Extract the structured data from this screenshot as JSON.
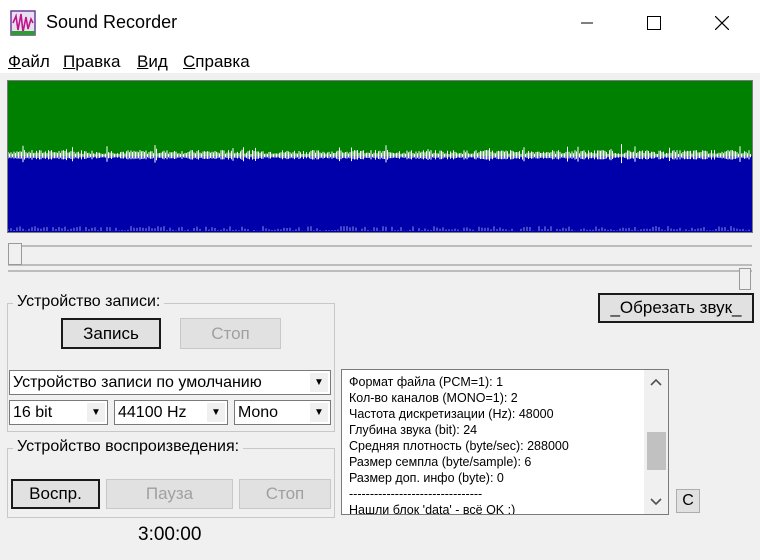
{
  "window": {
    "title": "Sound Recorder"
  },
  "menu": [
    {
      "accel": "Ф",
      "rest": "айл"
    },
    {
      "accel": "П",
      "rest": "равка"
    },
    {
      "accel": "В",
      "rest": "ид"
    },
    {
      "accel": "С",
      "rest": "правка"
    }
  ],
  "colors": {
    "wave_top": "#008000",
    "wave_bottom": "#0000aa",
    "wave_peaks": "#ffffff"
  },
  "trim_button": "_Обрезать звук_",
  "record_group": {
    "label": "Устройство записи:",
    "record_button": "Запись",
    "stop_button": "Стоп",
    "device": "Устройство записи по умолчанию",
    "bits": "16 bit",
    "rate": "44100 Hz",
    "channels": "Mono"
  },
  "playback_group": {
    "label": "Устройство воспроизведения:",
    "play_button": "Воспр.",
    "pause_button": "Пауза",
    "stop_button": "Стоп"
  },
  "info_lines": [
    "Формат файла (PCM=1): 1",
    "Кол-во каналов (MONO=1): 2",
    "Частота дискретизации (Hz): 48000",
    "Глубина звука (bit): 24",
    "Средняя плотность (byte/sec): 288000",
    "Размер семпла (byte/sample): 6",
    "Размер доп. инфо (byte): 0",
    "--------------------------------",
    "Нашли блок 'data' - всё OK :)"
  ],
  "clear_button": "С",
  "time": "3:00:00"
}
